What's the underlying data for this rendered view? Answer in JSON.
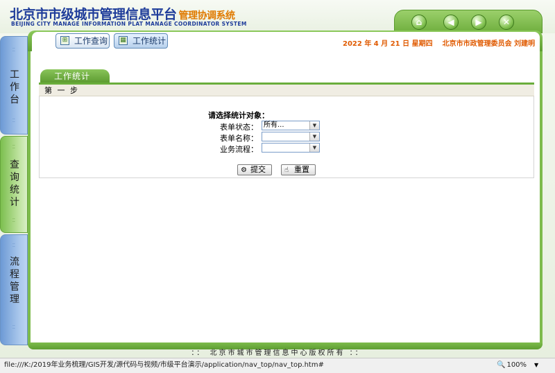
{
  "header": {
    "title_cn": "北京市市级城市管理信息平台",
    "subtitle_cn": "管理协调系统",
    "title_en": "BEIJING CITY MANAGE INFORMATION PLAT MANAGE COORDINATOR SYSTEM",
    "nav_icons": [
      "home-icon",
      "back-icon",
      "forward-icon",
      "close-icon"
    ]
  },
  "tabs": [
    {
      "label": "工作查询",
      "icon": "query-icon"
    },
    {
      "label": "工作统计",
      "icon": "stats-icon",
      "active": true
    }
  ],
  "dateline": {
    "date": "2022 年 4 月 21 日 星期四",
    "org_user": "北京市市政管理委员会 刘建明"
  },
  "sidebar": {
    "items": [
      {
        "label": "工作台"
      },
      {
        "label": "查询统计"
      },
      {
        "label": "流程管理"
      }
    ]
  },
  "content": {
    "tab_title": "工作统计",
    "step": "第 一 步",
    "form_title": "请选择统计对象：",
    "fields": [
      {
        "label": "表单状态：",
        "value": "所有..."
      },
      {
        "label": "表单名称：",
        "value": ""
      },
      {
        "label": "业务流程：",
        "value": ""
      }
    ],
    "submit_label": "提交",
    "reset_label": "重置"
  },
  "footer": {
    "text": "：： 北京市城市管理信息中心版权所有 ：："
  },
  "statusbar": {
    "url": "file:///K:/2019年业务梳理/GIS开发/源代码与视频/市级平台演示/application/nav_top/nav_top.htm#",
    "zoom": "100%"
  },
  "colors": {
    "brand_blue": "#1e3c9a",
    "accent_orange": "#e07a00",
    "frame_green": "#7dbb4c",
    "side_blue": "#6d9ad5"
  }
}
